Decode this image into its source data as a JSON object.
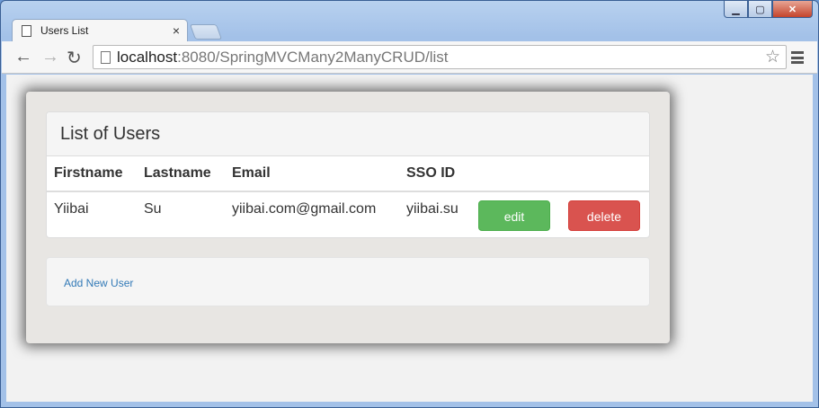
{
  "browser": {
    "tab_title": "Users List",
    "tab_close": "×",
    "url_host": "localhost",
    "url_rest": ":8080/SpringMVCMany2ManyCRUD/list",
    "window_controls": {
      "minimize": "▁",
      "maximize": "▢",
      "close": "✕"
    }
  },
  "panel": {
    "heading": "List of Users",
    "columns": [
      "Firstname",
      "Lastname",
      "Email",
      "SSO ID",
      "",
      ""
    ],
    "rows": [
      {
        "firstname": "Yiibai",
        "lastname": "Su",
        "email": "yiibai.com@gmail.com",
        "sso_id": "yiibai.su",
        "edit_label": "edit",
        "delete_label": "delete"
      }
    ]
  },
  "footer": {
    "add_user_label": "Add New User"
  },
  "colors": {
    "edit": "#5cb85c",
    "delete": "#d9534f",
    "link": "#337ab7"
  }
}
